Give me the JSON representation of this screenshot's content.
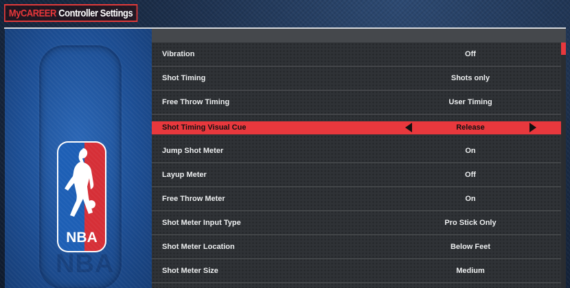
{
  "header": {
    "title_part1": "MyCAREER",
    "title_part2": "Controller Settings"
  },
  "logo": {
    "text": "NBA",
    "colors": {
      "blue": "#1d5fb5",
      "red": "#d62f37",
      "white": "#ffffff"
    }
  },
  "settings": [
    {
      "label": "Vibration",
      "value": "Off",
      "selected": false
    },
    {
      "label": "Shot Timing",
      "value": "Shots only",
      "selected": false
    },
    {
      "label": "Free Throw Timing",
      "value": "User Timing",
      "selected": false
    },
    {
      "label": "Shot Timing Visual Cue",
      "value": "Release",
      "selected": true
    },
    {
      "label": "Jump Shot Meter",
      "value": "On",
      "selected": false
    },
    {
      "label": "Layup Meter",
      "value": "Off",
      "selected": false
    },
    {
      "label": "Free Throw Meter",
      "value": "On",
      "selected": false
    },
    {
      "label": "Shot Meter Input Type",
      "value": "Pro Stick Only",
      "selected": false
    },
    {
      "label": "Shot Meter Location",
      "value": "Below Feet",
      "selected": false
    },
    {
      "label": "Shot Meter Size",
      "value": "Medium",
      "selected": false
    }
  ],
  "colors": {
    "accent": "#e8383d",
    "panel": "#2f3236",
    "text": "#eceeef"
  },
  "icons": {
    "prev": "triangle-left-icon",
    "next": "triangle-right-icon"
  }
}
